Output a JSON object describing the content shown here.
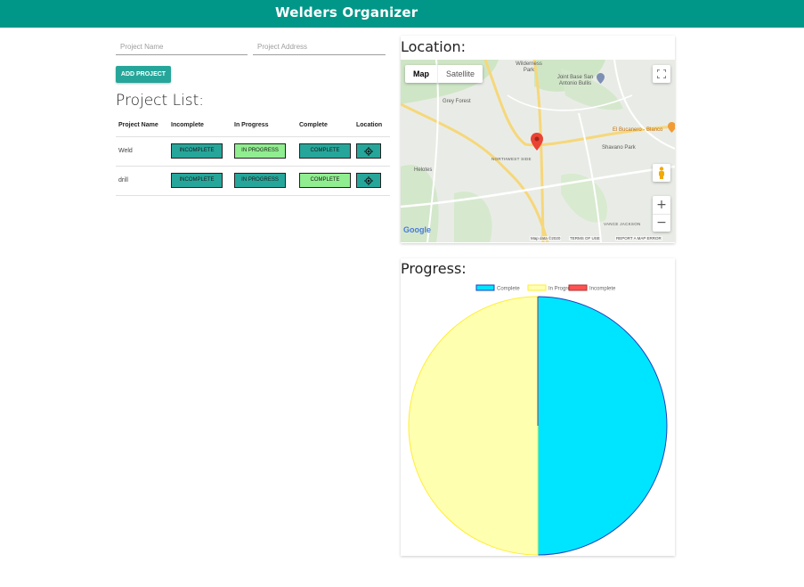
{
  "app": {
    "title": "Welders Organizer"
  },
  "form": {
    "name_placeholder": "Project Name",
    "address_placeholder": "Project Address",
    "add_label": "ADD PROJECT"
  },
  "list": {
    "title": "Project List:",
    "columns": [
      "Project Name",
      "Incomplete",
      "In Progress",
      "Complete",
      "Location"
    ],
    "rows": [
      {
        "name": "Weld",
        "incomplete": "INCOMPLETE",
        "in_progress": "IN PROGRESS",
        "complete": "COMPLETE",
        "active": "in_progress"
      },
      {
        "name": "drill",
        "incomplete": "INCOMPLETE",
        "in_progress": "IN PROGRESS",
        "complete": "COMPLETE",
        "active": "complete"
      }
    ]
  },
  "map": {
    "title": "Location:",
    "tabs": {
      "map": "Map",
      "satellite": "Satellite"
    },
    "labels": {
      "wilderness": "Wilderness Park",
      "joint_base": "Joint Base San Antonio Bullis",
      "grey_forest": "Grey Forest",
      "el_bucanero": "El Bucanero - Blanco",
      "shavano": "Shavano Park",
      "helotes": "Helotes",
      "northwest_side": "NORTHWEST SIDE",
      "vance_jackson": "VANCE JACKSON"
    },
    "logo": "Google",
    "footer": {
      "data": "Map data ©2020",
      "terms": "TERMS OF USE",
      "report": "REPORT A MAP ERROR"
    },
    "zoom_in": "+",
    "zoom_out": "−"
  },
  "progress": {
    "title": "Progress:"
  },
  "chart_data": {
    "type": "pie",
    "categories": [
      "Complete",
      "In Progress",
      "Incomplete"
    ],
    "values": [
      1,
      1,
      0
    ],
    "colors": [
      "#00e5ff",
      "#ffffb0",
      "#ff5252"
    ],
    "border_colors": [
      "#1e3fbf",
      "#ffee33",
      "#b03030"
    ],
    "legend_position": "top"
  },
  "colors": {
    "navbar": "#009688",
    "button": "#26a69a",
    "active_status": "#90ee90"
  }
}
